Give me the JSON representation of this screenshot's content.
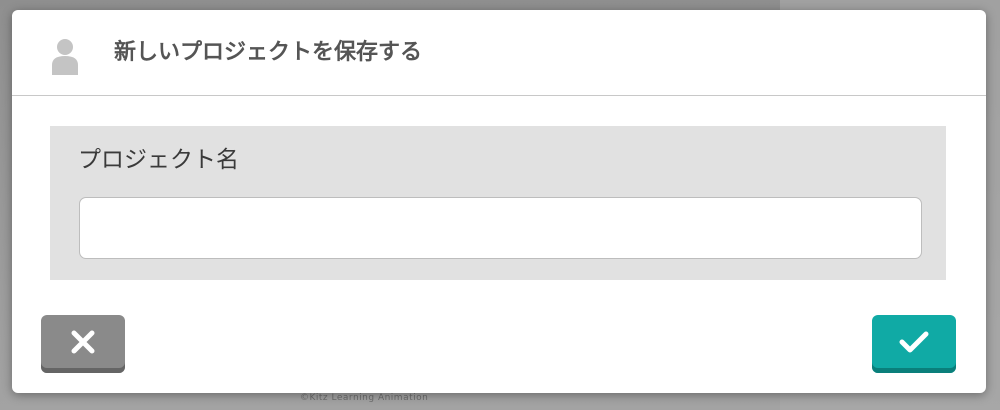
{
  "dialog": {
    "title": "新しいプロジェクトを保存する",
    "header_icon": "user-icon",
    "field": {
      "label": "プロジェクト名",
      "value": "",
      "placeholder": ""
    },
    "cancel_button": {
      "icon": "close-icon",
      "color": "#8a8a8a"
    },
    "confirm_button": {
      "icon": "checkmark-icon",
      "color": "#10aaa5"
    }
  },
  "background": {
    "caption": "©Kitz Learning Animation"
  }
}
